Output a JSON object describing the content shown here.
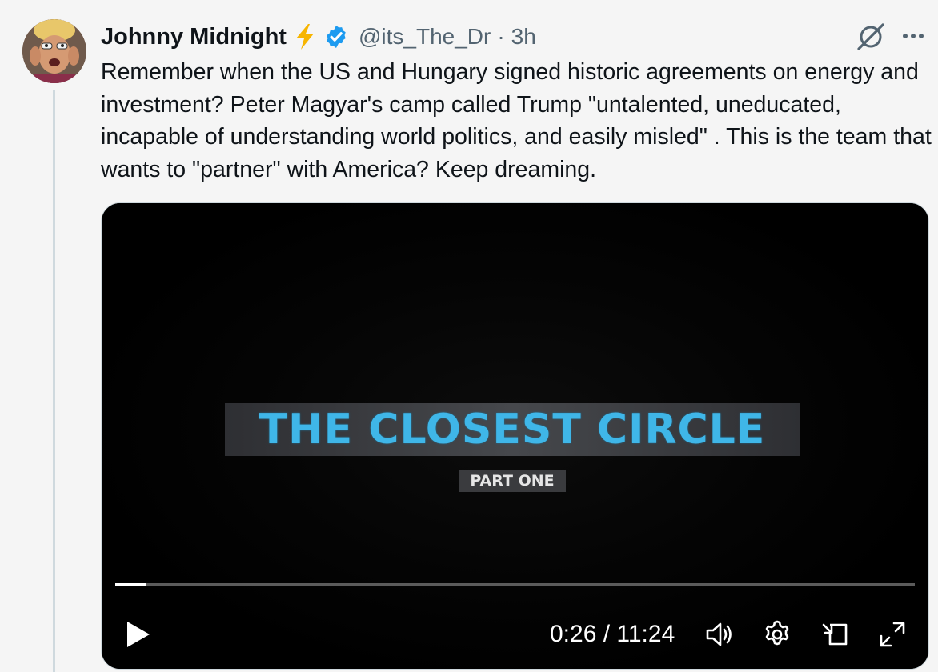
{
  "author": {
    "name": "Johnny Midnight",
    "handle": "@its_The_Dr",
    "separator": "·",
    "time": "3h"
  },
  "tweet": {
    "text": "Remember when the US and Hungary signed historic agreements on energy and investment? Peter Magyar's camp called Trump \"untalented, uneducated, incapable of understanding world politics, and easily misled\" . This is the team that wants to \"partner\" with America? Keep dreaming."
  },
  "video": {
    "title": "THE CLOSEST CIRCLE",
    "subtitle": "PART ONE",
    "current_time": "0:26",
    "duration": "11:24",
    "time_separator": " / ",
    "progress_fraction": 0.038
  },
  "icons": {
    "emoji": "lightning-bolt-icon",
    "verified": "verified-badge-icon",
    "grok": "grok-icon",
    "more": "more-icon",
    "play": "play-icon",
    "volume": "volume-icon",
    "settings": "gear-icon",
    "pip": "picture-in-picture-icon",
    "fullscreen": "fullscreen-icon"
  },
  "colors": {
    "verified_blue": "#1d9bf0",
    "bolt_yellow": "#f7b500",
    "title_cyan": "#3fb6e8",
    "secondary_text": "#536471"
  }
}
